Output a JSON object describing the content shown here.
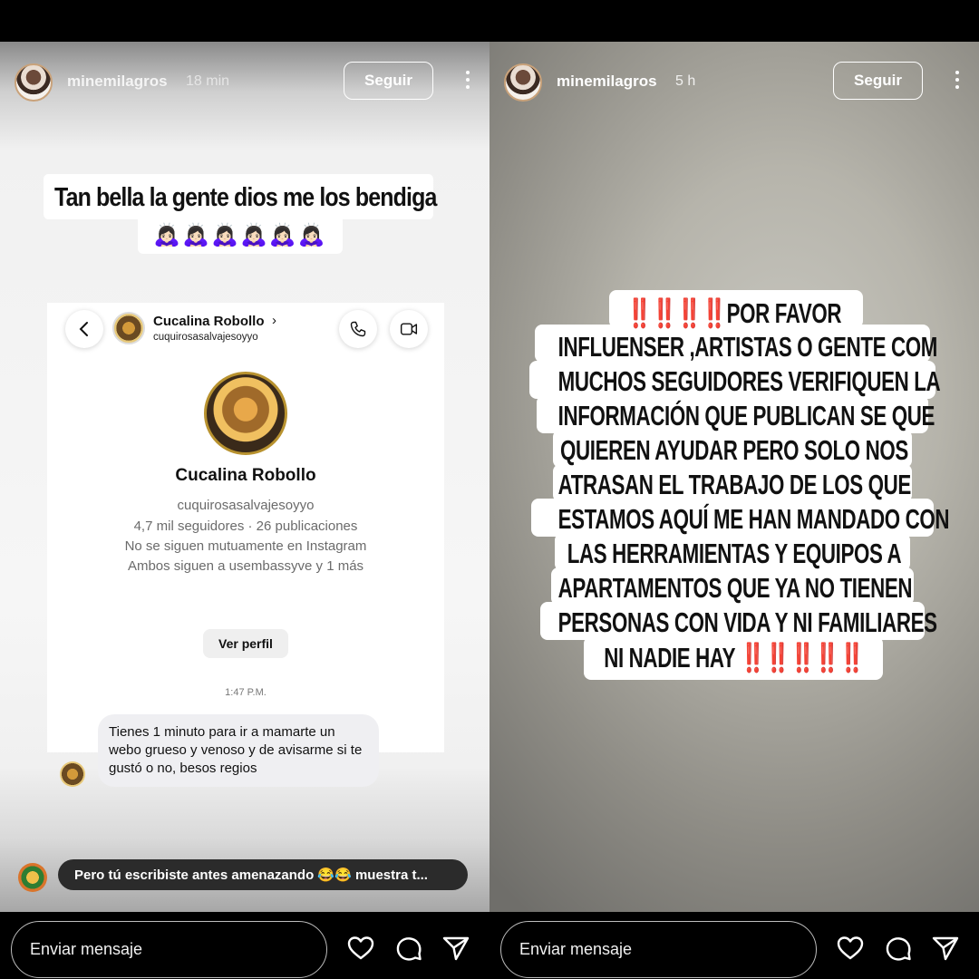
{
  "stories": [
    {
      "username": "minemilagros",
      "time_ago": "18 min",
      "follow_label": "Seguir",
      "caption_line": "Tan bella la gente dios me los bendiga",
      "caption_emoji": "🙇🏻‍♀️🙇🏻‍♀️🙇🏻‍♀️🙇🏻‍♀️🙇🏻‍♀️🙇🏻‍♀️",
      "dm_screenshot": {
        "contact_name": "Cucalina Robollo",
        "contact_handle": "cuquirosasalvajesoyyo",
        "profile_name": "Cucalina Robollo",
        "profile_handle": "cuquirosasalvajesoyyo",
        "stats": "4,7 mil seguidores · 26 publicaciones",
        "mutual_text": "No se siguen mutuamente en Instagram",
        "both_follow": "Ambos siguen a usembassyve y 1 más",
        "view_profile_label": "Ver perfil",
        "timestamp": "1:47 P.M.",
        "message": "Tienes 1 minuto para ir a mamarte un webo grueso y venoso y de avisarme si te gustó o no, besos regios"
      },
      "comment": "Pero tú escribiste antes amenazando 😂😂 muestra t...",
      "reply_placeholder": "Enviar mensaje"
    },
    {
      "username": "minemilagros",
      "time_ago": "5 h",
      "follow_label": "Seguir",
      "text_lines": [
        "‼️‼️‼️‼️POR FAVOR",
        "INFLUENSER ,ARTISTAS O GENTE COM",
        "MUCHOS SEGUIDORES  VERIFIQUEN LA",
        "INFORMACIÓN QUE PUBLICAN SE QUE",
        "QUIEREN AYUDAR PERO SOLO NOS",
        "ATRASAN EL TRABAJO DE LOS QUE",
        "ESTAMOS AQUÍ ME HAN MANDADO CON",
        "LAS HERRAMIENTAS Y EQUIPOS A",
        "APARTAMENTOS QUE YA NO TIENEN",
        "PERSONAS CON VIDA Y NI FAMILIARES",
        "NI NADIE HAY ‼️‼️‼️‼️‼️"
      ],
      "reply_placeholder": "Enviar mensaje"
    }
  ],
  "icons": {
    "like": "heart-icon",
    "comment": "comment-bubble-icon",
    "share": "send-icon",
    "more": "more-vertical-icon",
    "back": "chevron-left-icon",
    "call": "phone-icon",
    "video": "video-camera-icon"
  },
  "colors": {
    "background": "#000000",
    "bubble": "#efeff2",
    "comment_pill": "#2b2b2b"
  }
}
